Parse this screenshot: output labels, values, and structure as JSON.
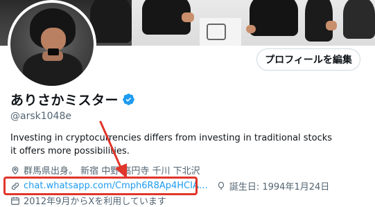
{
  "profile": {
    "edit_button_label": "プロフィールを編集",
    "display_name": "ありさかミスター",
    "handle": "@arsk1048e",
    "bio_lines": [
      "Investing in cryptocurrencies differs from investing in traditional stocks",
      "it offers more possibilities."
    ],
    "location": "群馬県出身。 新宿 中野 高円寺 千川 下北沢",
    "link": "chat.whatsapp.com/Cmph6R8Ap4HCIA…",
    "birthday": "誕生日: 1994年1月24日",
    "joined": "2012年9月からXを利用しています"
  },
  "icons": {
    "verified": "verified-badge-icon",
    "location": "location-pin-icon",
    "link": "link-icon",
    "birthday": "balloon-icon",
    "calendar": "calendar-icon"
  },
  "colors": {
    "accent": "#1d9bf0",
    "secondary_text": "#536471",
    "annotation": "#e0352b"
  }
}
